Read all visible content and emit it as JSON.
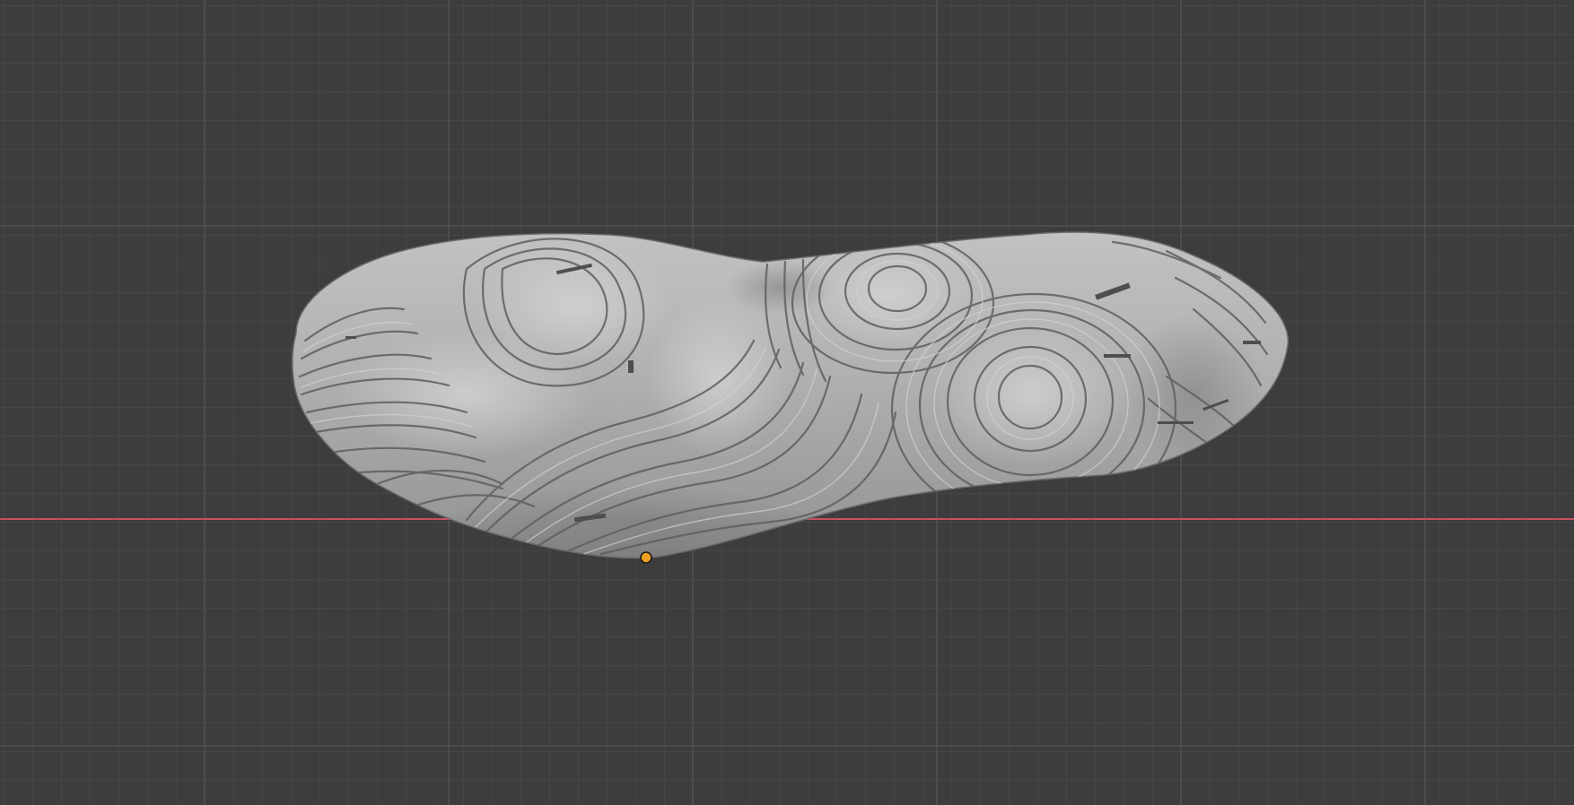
{
  "app": "3D Viewport",
  "viewport": {
    "background_color": "#3d3d3d",
    "grid_minor_color": "#4a4a4a",
    "grid_major_color": "#575757",
    "x_axis_color": "#c8505f",
    "show_grid": true,
    "show_x_axis": true
  },
  "object": {
    "type": "sculpted mesh",
    "shading": "solid",
    "base_color": "#a4a4a4",
    "highlight_color": "#c4c4c4",
    "shadow_color": "#6f6f6f",
    "contour_color": "#5a5a5a",
    "origin_marker_color": "#f0a020"
  }
}
